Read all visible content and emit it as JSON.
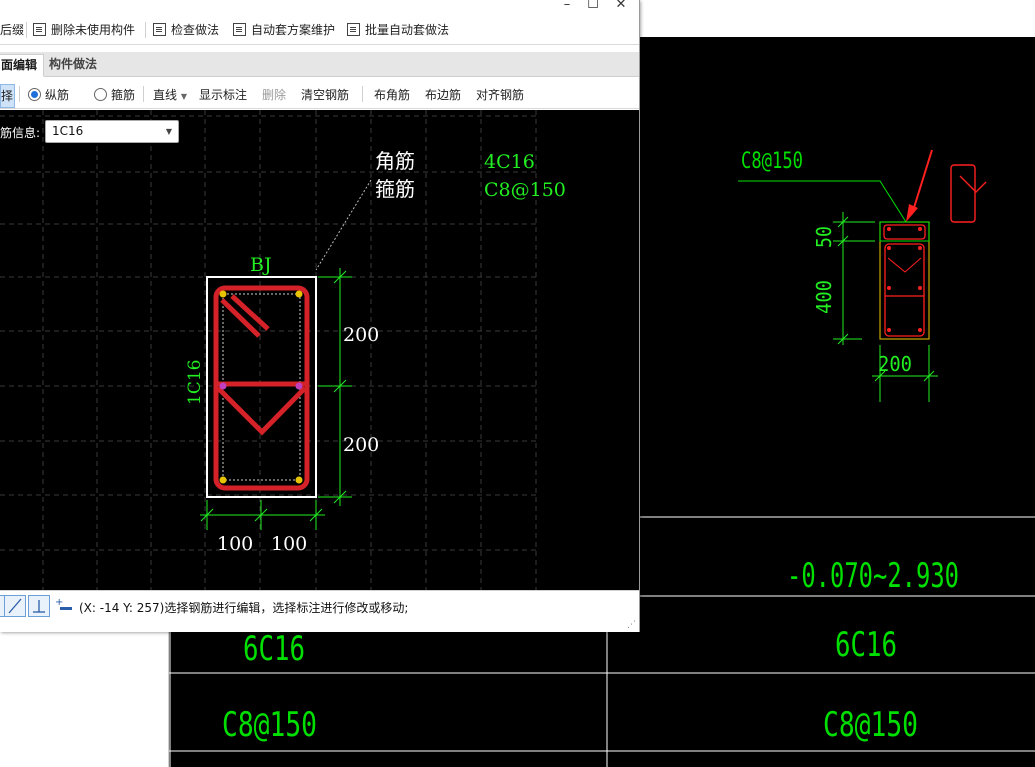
{
  "toolbar": {
    "items": [
      {
        "label": "后缀"
      },
      {
        "label": "删除未使用构件"
      },
      {
        "label": "检查做法"
      },
      {
        "label": "自动套方案维护"
      },
      {
        "label": "批量自动套做法"
      }
    ]
  },
  "tabs": [
    {
      "label": "面编辑",
      "active": true
    },
    {
      "label": "构件做法",
      "active": false
    }
  ],
  "ops": {
    "select": "择",
    "longitudinal": "纵筋",
    "stirrup": "箍筋",
    "line": "直线",
    "show_annotation": "显示标注",
    "delete": "删除",
    "clear": "清空钢筋",
    "corner": "布角筋",
    "edge": "布边筋",
    "align": "对齐钢筋"
  },
  "rebar_info": {
    "label": "筋信息:",
    "value": "1C16"
  },
  "section": {
    "name": "BJ",
    "corner_label": "角筋",
    "corner_value": "4C16",
    "stirrup_label": "箍筋",
    "stirrup_value": "C8@150",
    "side_label": "1C16",
    "dim_v1": "200",
    "dim_v2": "200",
    "dim_h1": "100",
    "dim_h2": "100"
  },
  "status": {
    "text": "(X: -14 Y: 257)选择钢筋进行编辑，选择标注进行修改或移动;"
  },
  "cad": {
    "stirrup_label": "C8@150",
    "dim_50": "50",
    "dim_400": "400",
    "dim_200": "200",
    "elevation": "-0.070~2.930",
    "long_bar_left": "6C16",
    "long_bar_right": "6C16",
    "stirrup_left": "C8@150",
    "stirrup_right": "C8@150"
  },
  "colors": {
    "rebar": "#d42228",
    "cad_green": "#00e000",
    "dim_green": "#22ee22",
    "cad_red": "#ff2020"
  }
}
